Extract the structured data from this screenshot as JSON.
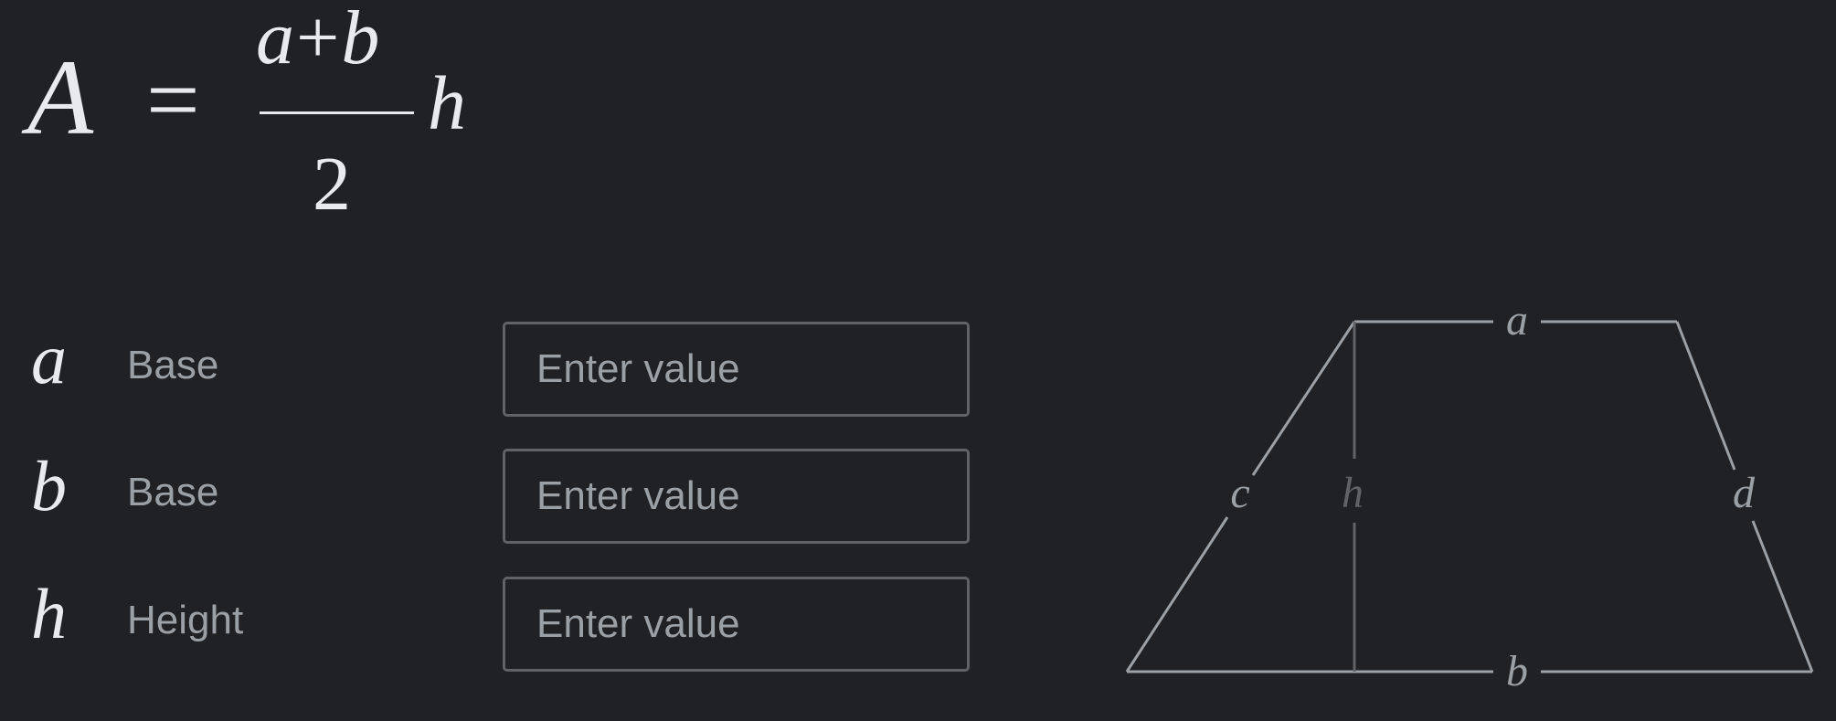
{
  "formula": {
    "lhs": "A",
    "equals": "=",
    "numerator_a": "a",
    "numerator_plus": "+",
    "numerator_b": "b",
    "denominator": "2",
    "factor": "h"
  },
  "inputs": [
    {
      "symbol": "a",
      "label": "Base",
      "placeholder": "Enter value",
      "value": ""
    },
    {
      "symbol": "b",
      "label": "Base",
      "placeholder": "Enter value",
      "value": ""
    },
    {
      "symbol": "h",
      "label": "Height",
      "placeholder": "Enter value",
      "value": ""
    }
  ],
  "diagram": {
    "shape": "trapezoid",
    "labels": {
      "top": "a",
      "bottom": "b",
      "left": "c",
      "right": "d",
      "height": "h"
    }
  },
  "colors": {
    "background": "#202124",
    "text_primary": "#e8eaed",
    "text_secondary": "#9aa0a6",
    "input_border": "#5f6368",
    "diagram_line": "#9aa0a6",
    "height_line": "#5f6368",
    "height_label": "#5f6368"
  }
}
